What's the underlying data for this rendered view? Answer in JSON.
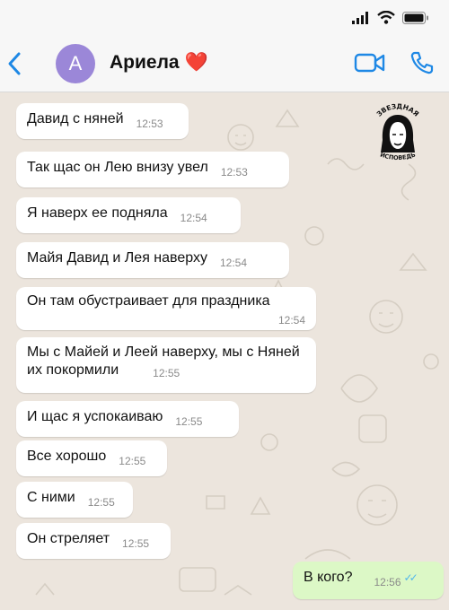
{
  "contact": {
    "initial": "A",
    "name": "Ариела",
    "emoji": "❤️"
  },
  "icons": {
    "back": "chevron-left-icon",
    "video": "video-camera-icon",
    "call": "phone-icon",
    "signal": "signal-icon",
    "wifi": "wifi-icon",
    "battery": "battery-icon"
  },
  "watermark": {
    "text_top": "ЗВЕЗДНАЯ",
    "text_bottom": "ИСПОВЕДЬ"
  },
  "colors": {
    "accent": "#1e88e5",
    "avatar": "#9b87d8",
    "incoming_bubble": "#ffffff",
    "outgoing_bubble": "#dcf8c6",
    "read_ticks": "#4fb6ec"
  },
  "messages": [
    {
      "text": "Давид с няней",
      "time": "12:53",
      "direction": "in"
    },
    {
      "text": "Так щас он Лею внизу увел",
      "time": "12:53",
      "direction": "in"
    },
    {
      "text": "Я наверх ее подняла",
      "time": "12:54",
      "direction": "in"
    },
    {
      "text": "Майя Давид и Лея наверху",
      "time": "12:54",
      "direction": "in"
    },
    {
      "text": "Он там обустраивает для праздника",
      "time": "12:54",
      "direction": "in"
    },
    {
      "text": "Мы с Майей и Леей наверху, мы с Няней их покормили",
      "time": "12:55",
      "direction": "in"
    },
    {
      "text": "И щас я успокаиваю",
      "time": "12:55",
      "direction": "in"
    },
    {
      "text": "Все хорошо",
      "time": "12:55",
      "direction": "in"
    },
    {
      "text": "С ними",
      "time": "12:55",
      "direction": "in"
    },
    {
      "text": "Он стреляет",
      "time": "12:55",
      "direction": "in"
    },
    {
      "text": "В кого?",
      "time": "12:56",
      "direction": "out",
      "status": "read"
    }
  ]
}
